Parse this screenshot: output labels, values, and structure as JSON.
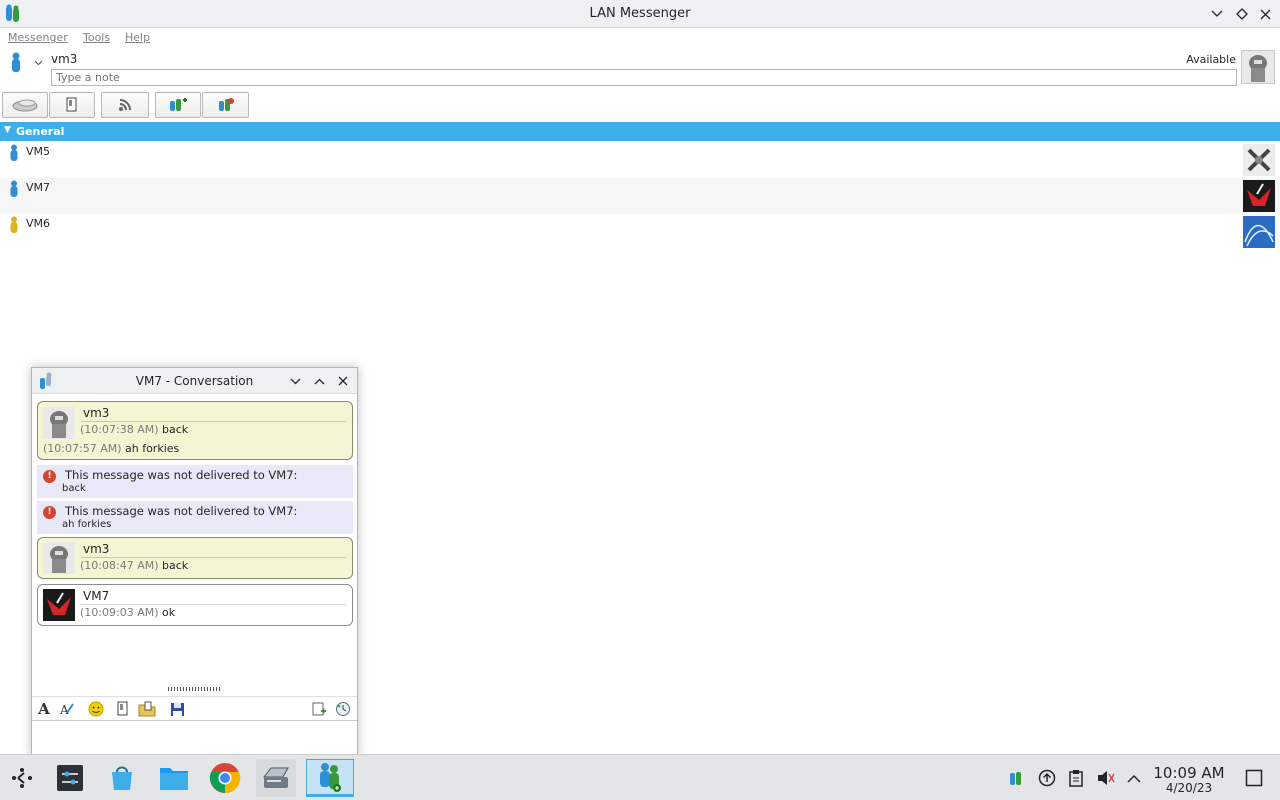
{
  "window": {
    "title": "LAN Messenger"
  },
  "menu": [
    "Messenger",
    "Tools",
    "Help"
  ],
  "user": {
    "name": "vm3",
    "status": "Available",
    "note_placeholder": "Type a note"
  },
  "toolbar": [
    "chat-room-icon",
    "file-transfer-icon",
    "broadcast-icon",
    "add-group-icon",
    "manage-contacts-icon"
  ],
  "group": {
    "name": "General",
    "contacts": [
      {
        "name": "VM5",
        "status_color": "#2f8fd5"
      },
      {
        "name": "VM7",
        "status_color": "#2f8fd5"
      },
      {
        "name": "VM6",
        "status_color": "#e0b21f"
      }
    ]
  },
  "conversation": {
    "title": "VM7 - Conversation",
    "messages": [
      {
        "type": "mine",
        "sender": "vm3",
        "lines": [
          {
            "time": "(10:07:38 AM)",
            "text": "back"
          },
          {
            "time": "(10:07:57 AM)",
            "text": "ah forkies"
          }
        ]
      },
      {
        "type": "error",
        "title": "This message was not delivered to VM7:",
        "text": "back"
      },
      {
        "type": "error",
        "title": "This message was not delivered to VM7:",
        "text": "ah forkies"
      },
      {
        "type": "mine",
        "sender": "vm3",
        "lines": [
          {
            "time": "(10:08:47 AM)",
            "text": "back"
          }
        ]
      },
      {
        "type": "theirs",
        "sender": "VM7",
        "lines": [
          {
            "time": "(10:09:03 AM)",
            "text": "ok"
          }
        ]
      }
    ]
  },
  "clock": {
    "time": "10:09 AM",
    "date": "4/20/23"
  }
}
